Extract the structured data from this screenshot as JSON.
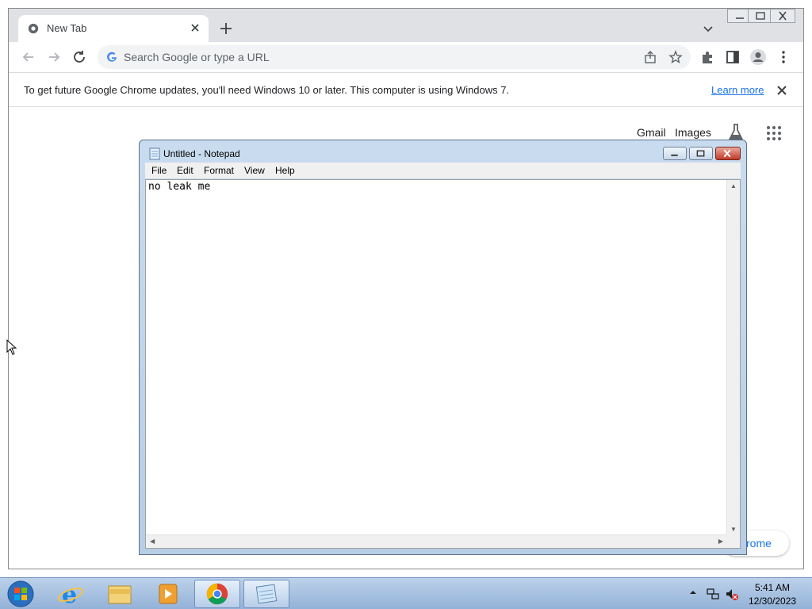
{
  "chrome": {
    "tab_title": "New Tab",
    "omnibox_placeholder": "Search Google or type a URL",
    "infobar": {
      "message": "To get future Google Chrome updates, you'll need Windows 10 or later. This computer is using Windows 7.",
      "link": "Learn more"
    },
    "ntp": {
      "gmail": "Gmail",
      "images": "Images",
      "customize_partial": "rome"
    }
  },
  "notepad": {
    "title": "Untitled - Notepad",
    "menu": [
      "File",
      "Edit",
      "Format",
      "View",
      "Help"
    ],
    "content": "no leak me"
  },
  "taskbar": {
    "apps": [
      "start-orb-icon",
      "internet-explorer-icon",
      "file-explorer-icon",
      "media-player-icon",
      "chrome-icon",
      "notepad-icon"
    ],
    "clock_time": "5:41 AM",
    "clock_date": "12/30/2023"
  },
  "colors": {
    "accent": "#1a73e8",
    "tabstrip": "#dfe1e5",
    "taskbar": "#bcd1ea"
  }
}
